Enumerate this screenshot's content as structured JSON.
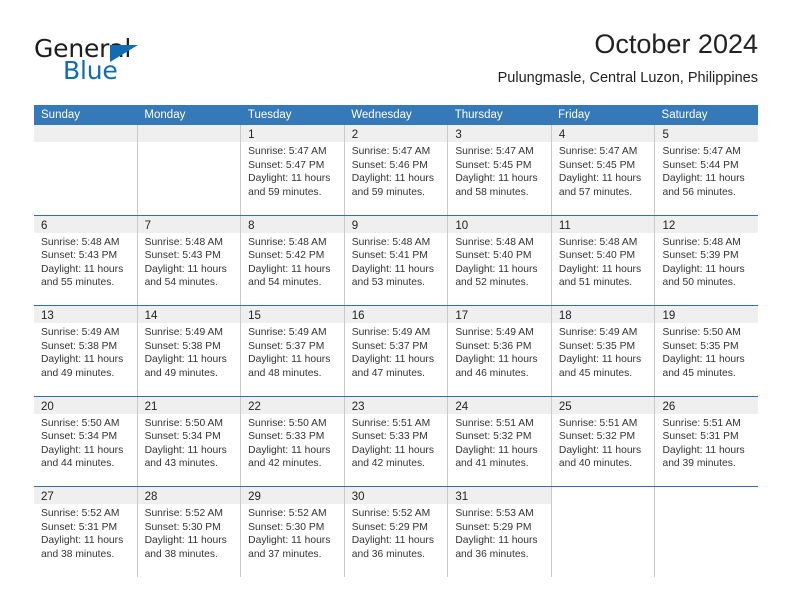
{
  "brand": {
    "word_one": "General",
    "word_two": "Blue",
    "triangle_icon": "triangle-icon",
    "accent_color": "#0f6cb5"
  },
  "header": {
    "title": "October 2024",
    "subtitle": "Pulungmasle, Central Luzon, Philippines"
  },
  "theme": {
    "header_blue": "#3679b9",
    "row_divider_blue": "#2f6fae",
    "daynum_band_gray": "#efefef",
    "cell_border_gray": "#c9c9c9"
  },
  "calendar": {
    "weekdays": [
      "Sunday",
      "Monday",
      "Tuesday",
      "Wednesday",
      "Thursday",
      "Friday",
      "Saturday"
    ],
    "weeks": [
      [
        {
          "day": "",
          "empty": true
        },
        {
          "day": "",
          "empty": true
        },
        {
          "day": "1",
          "sunrise": "Sunrise: 5:47 AM",
          "sunset": "Sunset: 5:47 PM",
          "daylight_1": "Daylight: 11 hours",
          "daylight_2": "and 59 minutes."
        },
        {
          "day": "2",
          "sunrise": "Sunrise: 5:47 AM",
          "sunset": "Sunset: 5:46 PM",
          "daylight_1": "Daylight: 11 hours",
          "daylight_2": "and 59 minutes."
        },
        {
          "day": "3",
          "sunrise": "Sunrise: 5:47 AM",
          "sunset": "Sunset: 5:45 PM",
          "daylight_1": "Daylight: 11 hours",
          "daylight_2": "and 58 minutes."
        },
        {
          "day": "4",
          "sunrise": "Sunrise: 5:47 AM",
          "sunset": "Sunset: 5:45 PM",
          "daylight_1": "Daylight: 11 hours",
          "daylight_2": "and 57 minutes."
        },
        {
          "day": "5",
          "sunrise": "Sunrise: 5:47 AM",
          "sunset": "Sunset: 5:44 PM",
          "daylight_1": "Daylight: 11 hours",
          "daylight_2": "and 56 minutes."
        }
      ],
      [
        {
          "day": "6",
          "sunrise": "Sunrise: 5:48 AM",
          "sunset": "Sunset: 5:43 PM",
          "daylight_1": "Daylight: 11 hours",
          "daylight_2": "and 55 minutes."
        },
        {
          "day": "7",
          "sunrise": "Sunrise: 5:48 AM",
          "sunset": "Sunset: 5:43 PM",
          "daylight_1": "Daylight: 11 hours",
          "daylight_2": "and 54 minutes."
        },
        {
          "day": "8",
          "sunrise": "Sunrise: 5:48 AM",
          "sunset": "Sunset: 5:42 PM",
          "daylight_1": "Daylight: 11 hours",
          "daylight_2": "and 54 minutes."
        },
        {
          "day": "9",
          "sunrise": "Sunrise: 5:48 AM",
          "sunset": "Sunset: 5:41 PM",
          "daylight_1": "Daylight: 11 hours",
          "daylight_2": "and 53 minutes."
        },
        {
          "day": "10",
          "sunrise": "Sunrise: 5:48 AM",
          "sunset": "Sunset: 5:40 PM",
          "daylight_1": "Daylight: 11 hours",
          "daylight_2": "and 52 minutes."
        },
        {
          "day": "11",
          "sunrise": "Sunrise: 5:48 AM",
          "sunset": "Sunset: 5:40 PM",
          "daylight_1": "Daylight: 11 hours",
          "daylight_2": "and 51 minutes."
        },
        {
          "day": "12",
          "sunrise": "Sunrise: 5:48 AM",
          "sunset": "Sunset: 5:39 PM",
          "daylight_1": "Daylight: 11 hours",
          "daylight_2": "and 50 minutes."
        }
      ],
      [
        {
          "day": "13",
          "sunrise": "Sunrise: 5:49 AM",
          "sunset": "Sunset: 5:38 PM",
          "daylight_1": "Daylight: 11 hours",
          "daylight_2": "and 49 minutes."
        },
        {
          "day": "14",
          "sunrise": "Sunrise: 5:49 AM",
          "sunset": "Sunset: 5:38 PM",
          "daylight_1": "Daylight: 11 hours",
          "daylight_2": "and 49 minutes."
        },
        {
          "day": "15",
          "sunrise": "Sunrise: 5:49 AM",
          "sunset": "Sunset: 5:37 PM",
          "daylight_1": "Daylight: 11 hours",
          "daylight_2": "and 48 minutes."
        },
        {
          "day": "16",
          "sunrise": "Sunrise: 5:49 AM",
          "sunset": "Sunset: 5:37 PM",
          "daylight_1": "Daylight: 11 hours",
          "daylight_2": "and 47 minutes."
        },
        {
          "day": "17",
          "sunrise": "Sunrise: 5:49 AM",
          "sunset": "Sunset: 5:36 PM",
          "daylight_1": "Daylight: 11 hours",
          "daylight_2": "and 46 minutes."
        },
        {
          "day": "18",
          "sunrise": "Sunrise: 5:49 AM",
          "sunset": "Sunset: 5:35 PM",
          "daylight_1": "Daylight: 11 hours",
          "daylight_2": "and 45 minutes."
        },
        {
          "day": "19",
          "sunrise": "Sunrise: 5:50 AM",
          "sunset": "Sunset: 5:35 PM",
          "daylight_1": "Daylight: 11 hours",
          "daylight_2": "and 45 minutes."
        }
      ],
      [
        {
          "day": "20",
          "sunrise": "Sunrise: 5:50 AM",
          "sunset": "Sunset: 5:34 PM",
          "daylight_1": "Daylight: 11 hours",
          "daylight_2": "and 44 minutes."
        },
        {
          "day": "21",
          "sunrise": "Sunrise: 5:50 AM",
          "sunset": "Sunset: 5:34 PM",
          "daylight_1": "Daylight: 11 hours",
          "daylight_2": "and 43 minutes."
        },
        {
          "day": "22",
          "sunrise": "Sunrise: 5:50 AM",
          "sunset": "Sunset: 5:33 PM",
          "daylight_1": "Daylight: 11 hours",
          "daylight_2": "and 42 minutes."
        },
        {
          "day": "23",
          "sunrise": "Sunrise: 5:51 AM",
          "sunset": "Sunset: 5:33 PM",
          "daylight_1": "Daylight: 11 hours",
          "daylight_2": "and 42 minutes."
        },
        {
          "day": "24",
          "sunrise": "Sunrise: 5:51 AM",
          "sunset": "Sunset: 5:32 PM",
          "daylight_1": "Daylight: 11 hours",
          "daylight_2": "and 41 minutes."
        },
        {
          "day": "25",
          "sunrise": "Sunrise: 5:51 AM",
          "sunset": "Sunset: 5:32 PM",
          "daylight_1": "Daylight: 11 hours",
          "daylight_2": "and 40 minutes."
        },
        {
          "day": "26",
          "sunrise": "Sunrise: 5:51 AM",
          "sunset": "Sunset: 5:31 PM",
          "daylight_1": "Daylight: 11 hours",
          "daylight_2": "and 39 minutes."
        }
      ],
      [
        {
          "day": "27",
          "sunrise": "Sunrise: 5:52 AM",
          "sunset": "Sunset: 5:31 PM",
          "daylight_1": "Daylight: 11 hours",
          "daylight_2": "and 38 minutes."
        },
        {
          "day": "28",
          "sunrise": "Sunrise: 5:52 AM",
          "sunset": "Sunset: 5:30 PM",
          "daylight_1": "Daylight: 11 hours",
          "daylight_2": "and 38 minutes."
        },
        {
          "day": "29",
          "sunrise": "Sunrise: 5:52 AM",
          "sunset": "Sunset: 5:30 PM",
          "daylight_1": "Daylight: 11 hours",
          "daylight_2": "and 37 minutes."
        },
        {
          "day": "30",
          "sunrise": "Sunrise: 5:52 AM",
          "sunset": "Sunset: 5:29 PM",
          "daylight_1": "Daylight: 11 hours",
          "daylight_2": "and 36 minutes."
        },
        {
          "day": "31",
          "sunrise": "Sunrise: 5:53 AM",
          "sunset": "Sunset: 5:29 PM",
          "daylight_1": "Daylight: 11 hours",
          "daylight_2": "and 36 minutes."
        },
        {
          "day": "",
          "empty": true,
          "blank": true
        },
        {
          "day": "",
          "empty": true,
          "blank": true
        }
      ]
    ]
  }
}
